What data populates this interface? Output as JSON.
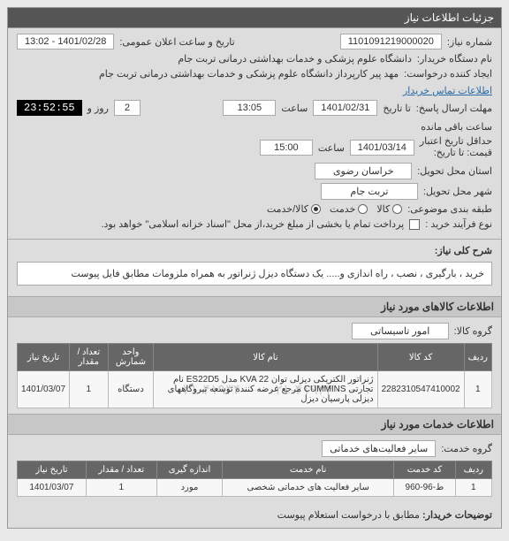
{
  "panel": {
    "title": "جزئیات اطلاعات نیاز"
  },
  "fields": {
    "need_no_label": "شماره نیاز:",
    "need_no": "1101091219000020",
    "announce_label": "تاریخ و ساعت اعلان عمومی:",
    "announce_value": "1401/02/28 - 13:02",
    "buyer_label": "نام دستگاه خریدار:",
    "buyer_value": "دانشگاه علوم پزشکی و خدمات بهداشتی درمانی تربت جام",
    "creator_label": "ایجاد کننده درخواست:",
    "creator_value": "مهد پیر کارپرداز دانشگاه علوم پزشکی و خدمات بهداشتی درمانی تربت جام",
    "contact_link": "اطلاعات تماس خریدار",
    "deadline_label": "مهلت ارسال پاسخ:",
    "deadline_date_label": "تا تاریخ",
    "deadline_date": "1401/02/31",
    "time_label": "ساعت",
    "deadline_time": "13:05",
    "day_label": "روز و",
    "days_remaining": "2",
    "timer_value": "23:52:55",
    "remaining_label": "ساعت باقی مانده",
    "validity_label": "حداقل تاریخ اعتبار",
    "validity_sub": "قیمت: تا تاریخ:",
    "validity_date": "1401/03/14",
    "validity_time": "15:00",
    "province_label": "استان محل تحویل:",
    "province_value": "خراسان رضوی",
    "city_label": "شهر محل تحویل:",
    "city_value": "تربت جام",
    "classify_label": "طبقه بندی موضوعی:",
    "radio_goods": "کالا",
    "radio_service": "خدمت",
    "radio_both": "کالا/خدمت",
    "process_label": "نوع فرآیند خرید :",
    "process_note": "پرداخت تمام یا بخشی از مبلغ خرید،از محل \"اسناد خزانه اسلامی\" خواهد بود."
  },
  "summary": {
    "label": "شرح کلی نیاز:",
    "text": "خرید ، بارگیری ، نصب ، راه اندازی و..... یک دستگاه دیزل ژنراتور به همراه ملزومات مطابق فایل پیوست"
  },
  "goods": {
    "section": "اطلاعات كالاهای مورد نياز",
    "group_label": "گروه کالا:",
    "group_value": "امور تاسیساتی",
    "headers": {
      "row": "ردیف",
      "code": "کد کالا",
      "name": "نام کالا",
      "unit": "واحد شمارش",
      "qty": "تعداد / مقدار",
      "date": "تاریخ نیاز"
    },
    "items": [
      {
        "row": "1",
        "code": "2282310547410002",
        "name": "ژنراتور الكتريكی ديزلی توان KVA 22 مدل ES22D5 نام تجارتی CUMMINS مرجع عرضه كننده توسعه نیروگاههای دیزلی پارسیان دیزل",
        "unit": "دستگاه",
        "qty": "1",
        "date": "1401/03/07"
      }
    ],
    "watermark": "۰۲۱-۴۱۹۳۴۰۰۰   ۰۲۱-۴۱۹۳۴۰۰۰"
  },
  "services": {
    "section": "اطلاعات خدمات مورد نیاز",
    "group_label": "گروه خدمت:",
    "group_value": "سایر فعالیت‌های خدماتی",
    "headers": {
      "row": "ردیف",
      "code": "کد خدمت",
      "name": "نام خدمت",
      "unit": "اندازه گیری",
      "qty": "تعداد / مقدار",
      "date": "تاریخ نیاز"
    },
    "items": [
      {
        "row": "1",
        "code": "ط-96-960",
        "name": "سایر فعالیت های خدماتی شخصی",
        "unit": "مورد",
        "qty": "1",
        "date": "1401/03/07"
      }
    ]
  },
  "footer": {
    "buyer_desc_label": "توضیحات خریدار:",
    "buyer_desc_text": "مطابق با درخواست استعلام پیوست"
  }
}
